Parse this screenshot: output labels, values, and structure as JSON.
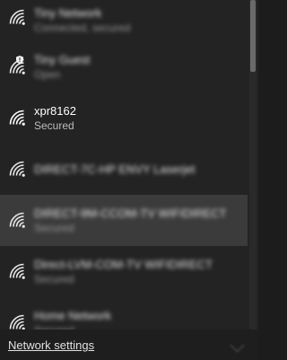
{
  "networks": [
    {
      "name": "Tiny Network",
      "status": "Connected, secured",
      "blurred": true,
      "shield": false
    },
    {
      "name": "Tiny Guest",
      "status": "Open",
      "blurred": true,
      "shield": true
    },
    {
      "name": "xpr8162",
      "status": "Secured",
      "blurred": false,
      "shield": false
    },
    {
      "name": "DIRECT-7C-HP ENVY Laserjet",
      "status": "",
      "blurred": true,
      "shield": false
    },
    {
      "name": "DIRECT-9M-CCOM-TV WIFIDIRECT",
      "status": "Secured",
      "blurred": true,
      "shield": false
    },
    {
      "name": "Direct-LVM-COM-TV WIFIDIRECT",
      "status": "Secured",
      "blurred": true,
      "shield": false
    },
    {
      "name": "Home Network",
      "status": "Secured",
      "blurred": true,
      "shield": false
    }
  ],
  "footer": {
    "settings_link": "Network settings"
  },
  "colors": {
    "background": "#232323",
    "hover": "#3b3b3b",
    "text": "#ffffff"
  }
}
